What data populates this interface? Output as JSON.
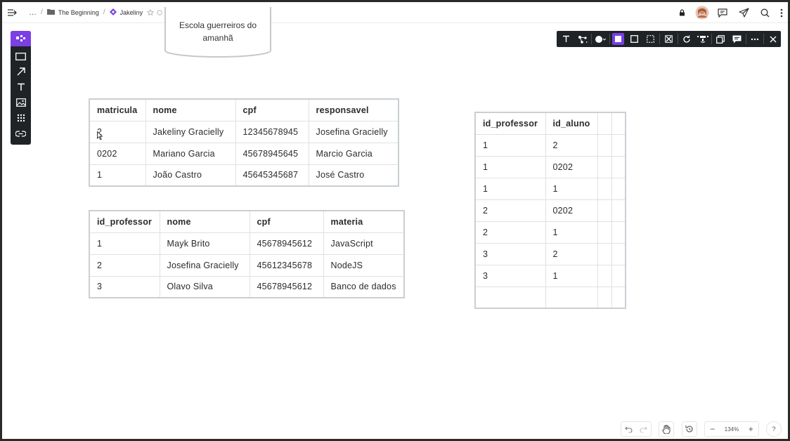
{
  "breadcrumb": {
    "more": "…",
    "folder": "The Beginning",
    "board": "Jakeliny"
  },
  "diagram": {
    "shape_text_line1": "Escola guerreiros do",
    "shape_text_line2": "amanhã"
  },
  "tables": {
    "alunos": {
      "headers": [
        "matricula",
        "nome",
        "cpf",
        "responsavel"
      ],
      "rows": [
        [
          "2",
          "Jakeliny Gracielly",
          "12345678945",
          "Josefina Gracielly"
        ],
        [
          "0202",
          "Mariano Garcia",
          "45678945645",
          "Marcio Garcia"
        ],
        [
          "1",
          "João Castro",
          "45645345687",
          "José Castro"
        ]
      ]
    },
    "professores": {
      "headers": [
        "id_professor",
        "nome",
        "cpf",
        "materia"
      ],
      "rows": [
        [
          "1",
          "Mayk Brito",
          "45678945612",
          "JavaScript"
        ],
        [
          "2",
          "Josefina Gracielly",
          "45612345678",
          "NodeJS"
        ],
        [
          "3",
          "Olavo Silva",
          "45678945612",
          "Banco de dados"
        ]
      ]
    },
    "professor_aluno": {
      "headers": [
        "id_professor",
        "id_aluno",
        "",
        ""
      ],
      "rows": [
        [
          "1",
          "2",
          "",
          ""
        ],
        [
          "1",
          "0202",
          "",
          ""
        ],
        [
          "1",
          "1",
          "",
          ""
        ],
        [
          "2",
          "0202",
          "",
          ""
        ],
        [
          "2",
          "1",
          "",
          ""
        ],
        [
          "3",
          "2",
          "",
          ""
        ],
        [
          "3",
          "1",
          "",
          ""
        ],
        [
          "",
          "",
          "",
          ""
        ]
      ]
    }
  },
  "bottom": {
    "zoom": "134%",
    "help": "?",
    "zoom_out": "−",
    "zoom_in": "+"
  },
  "colors": {
    "accent": "#7b3fe4",
    "toolbar": "#1f2326"
  }
}
